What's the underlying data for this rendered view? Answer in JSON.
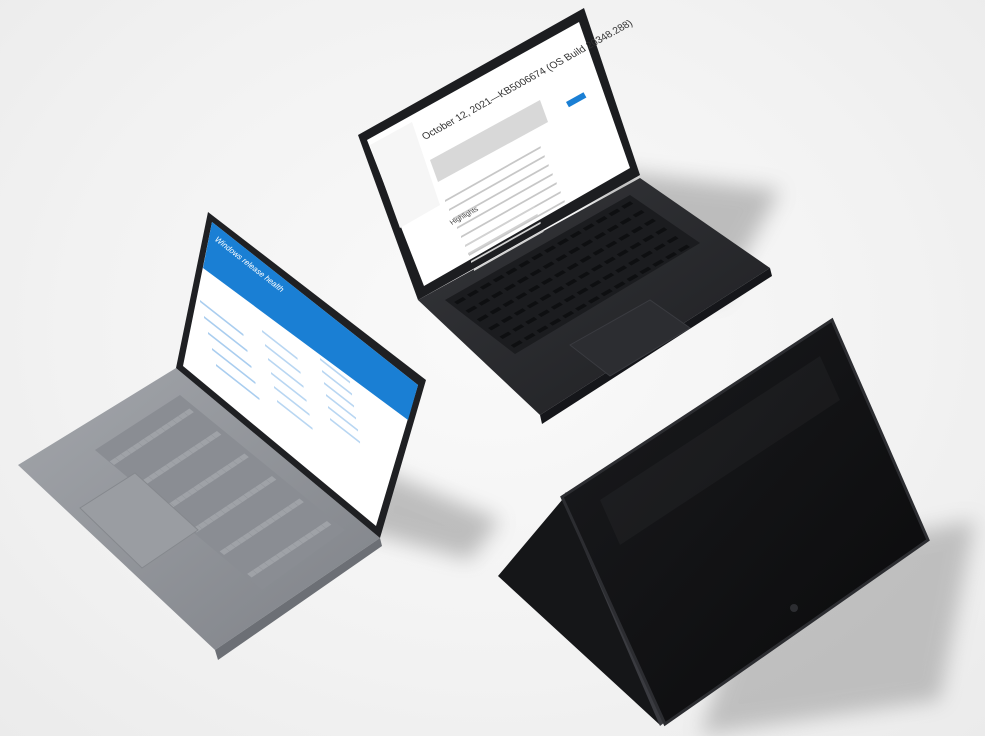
{
  "scene": {
    "background": "#f3f3f3",
    "devices": [
      {
        "name": "silver-laptop",
        "color": "#8e9197",
        "screen_page": {
          "accent": "#1a7fd4",
          "banner_title": "Windows release health"
        }
      },
      {
        "name": "black-laptop",
        "color": "#2a2b2f",
        "screen_page": {
          "heading": "October 12, 2021—KB5006674 (OS Build 20348.288)",
          "section_label": "Highlights"
        }
      },
      {
        "name": "black-convertible-tent",
        "color": "#111214",
        "screen_state": "off"
      }
    ]
  }
}
